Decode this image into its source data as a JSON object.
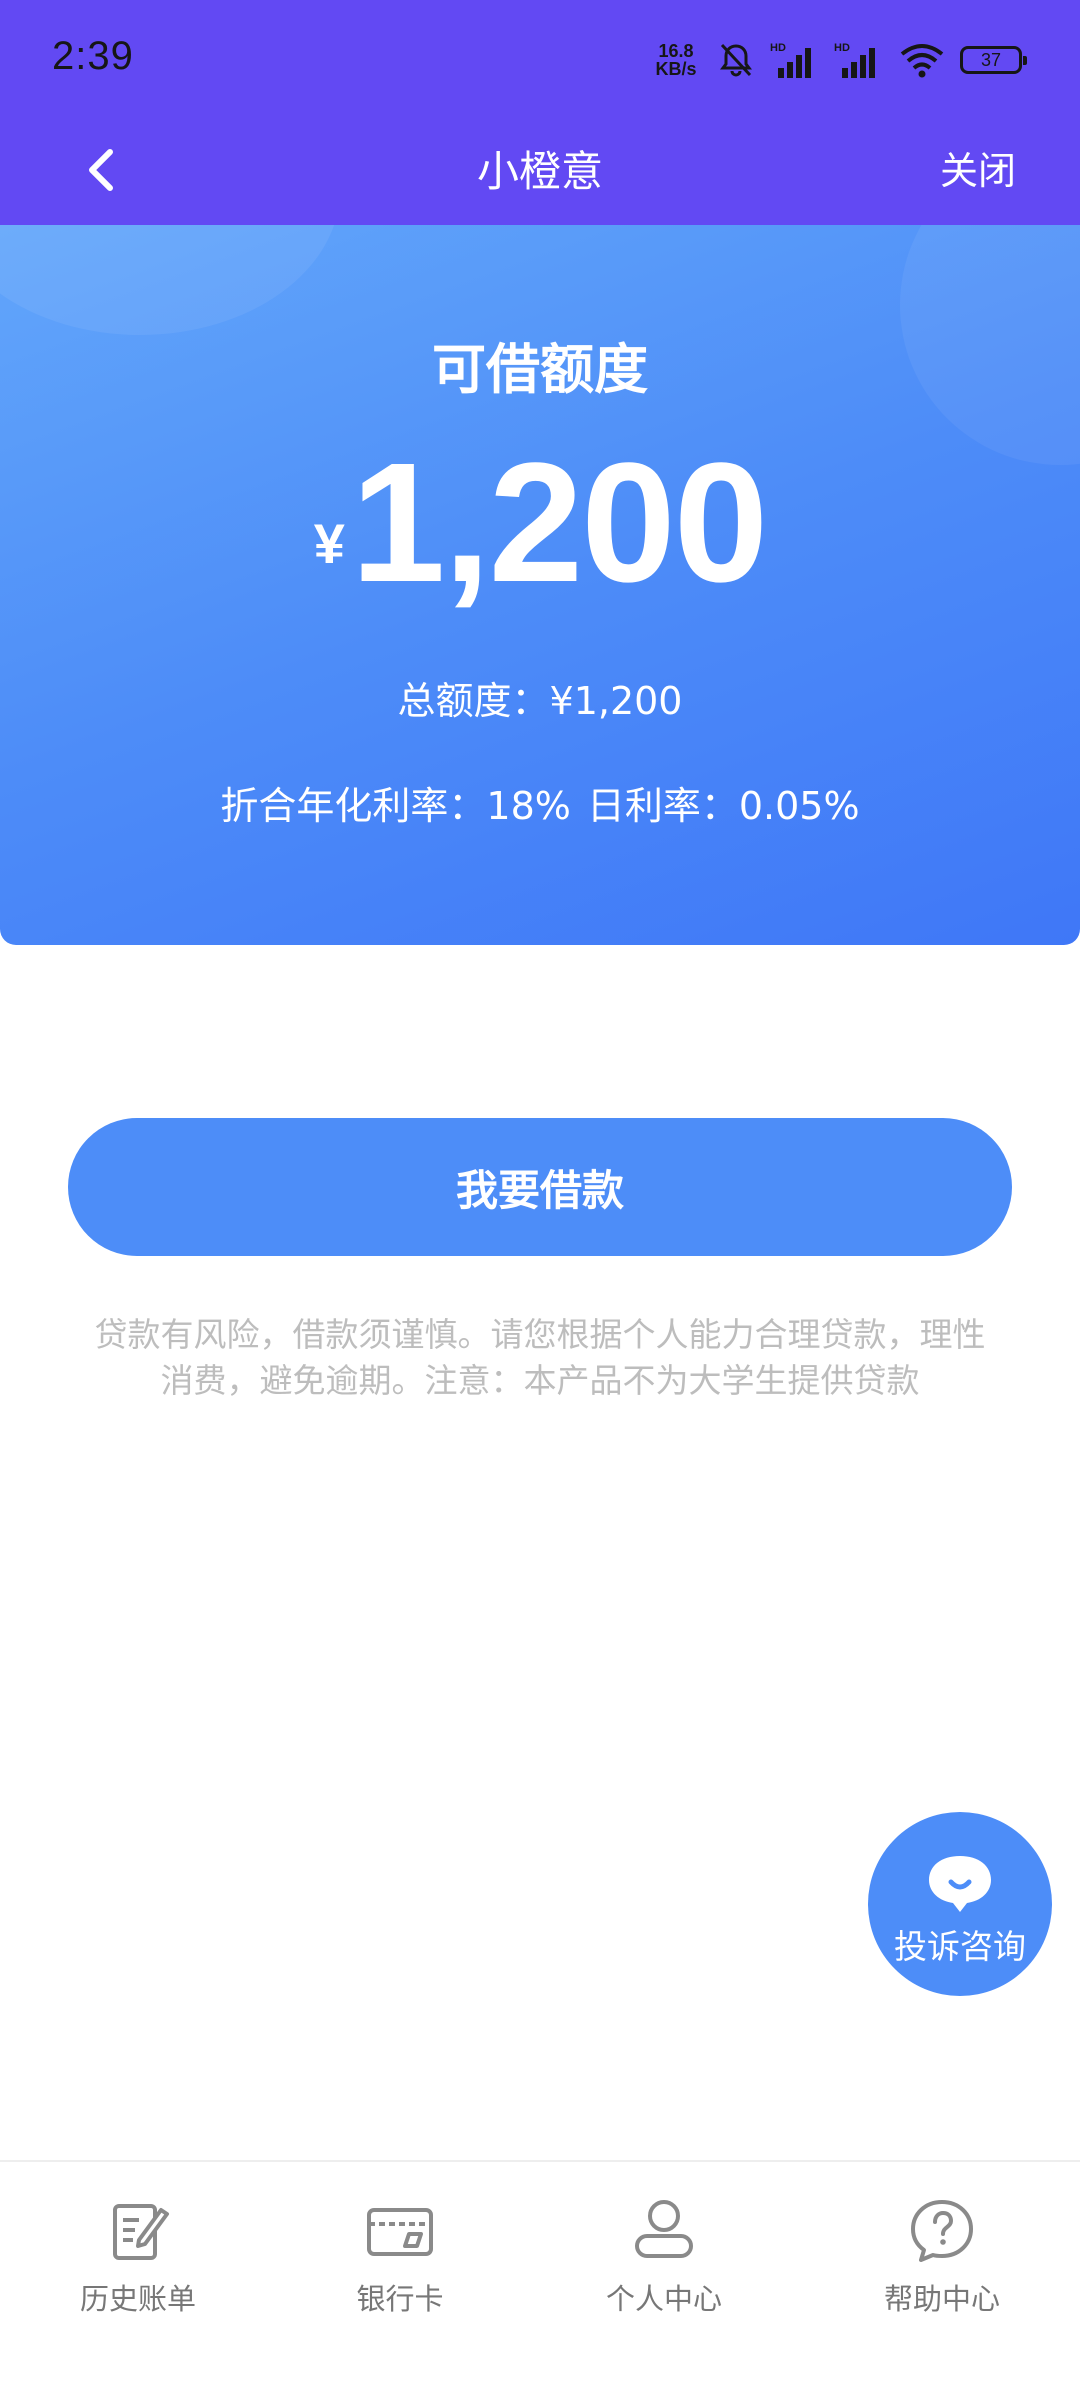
{
  "status_bar": {
    "time": "2:39",
    "net_speed_value": "16.8",
    "net_speed_unit": "KB/s",
    "battery": "37"
  },
  "nav": {
    "title": "小橙意",
    "close_label": "关闭"
  },
  "hero": {
    "label": "可借额度",
    "currency": "¥",
    "amount": "1,200",
    "total_quota": "总额度：¥1,200",
    "annual_rate": "折合年化利率：18%",
    "daily_rate": "日利率：0.05%"
  },
  "borrow_button_label": "我要借款",
  "disclaimer_line1": "贷款有风险，借款须谨慎。请您根据个人能力合理贷款，理性",
  "disclaimer_line2": "消费，避免逾期。注意：本产品不为大学生提供贷款",
  "float_button_label": "投诉咨询",
  "tabs": [
    {
      "label": "历史账单",
      "icon": "bill-edit-icon"
    },
    {
      "label": "银行卡",
      "icon": "bank-card-icon"
    },
    {
      "label": "个人中心",
      "icon": "user-icon"
    },
    {
      "label": "帮助中心",
      "icon": "help-icon"
    }
  ],
  "colors": {
    "header": "#6249F3",
    "primary": "#4D8DF8",
    "disclaimer_text": "#BDBDBD",
    "tab_text": "#777777"
  }
}
